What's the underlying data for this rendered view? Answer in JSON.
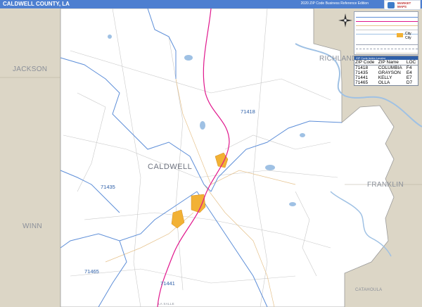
{
  "title": "CALDWELL COUNTY, LA",
  "edition": "2020 ZIP Code Business Reference Edition",
  "logo_text": [
    "MARKET",
    "MAPS"
  ],
  "legend": {
    "city_labels": [
      "City",
      "City"
    ]
  },
  "county_labels": {
    "center": "CALDWELL",
    "west_north": "JACKSON",
    "west_south": "WINN",
    "east_north": "RICHLAND",
    "east_south": "FRANKLIN",
    "south_east": "CATAHOULA",
    "south_bottom": "LA SALLE"
  },
  "zip_labels": [
    {
      "code": "71418"
    },
    {
      "code": "71435"
    },
    {
      "code": "71441"
    },
    {
      "code": "71465"
    }
  ],
  "zip_table": {
    "header": "ZIP Code Index Locator",
    "columns": [
      "ZIP Code",
      "ZIP Name",
      "LOC"
    ],
    "rows": [
      [
        "71418",
        "COLUMBIA",
        "F4"
      ],
      [
        "71435",
        "GRAYSON",
        "E4"
      ],
      [
        "71441",
        "KELLY",
        "E7"
      ],
      [
        "71465",
        "OLLA",
        "D7"
      ]
    ]
  },
  "colors": {
    "title_bar": "#4d7fd0",
    "outside_land": "#dcd6c6",
    "water": "#9fc1e4",
    "zip_boundary": "#5d8ed8",
    "highway": "#e0168c",
    "urban": "#f2b134",
    "roads": "#c9c9c9"
  }
}
